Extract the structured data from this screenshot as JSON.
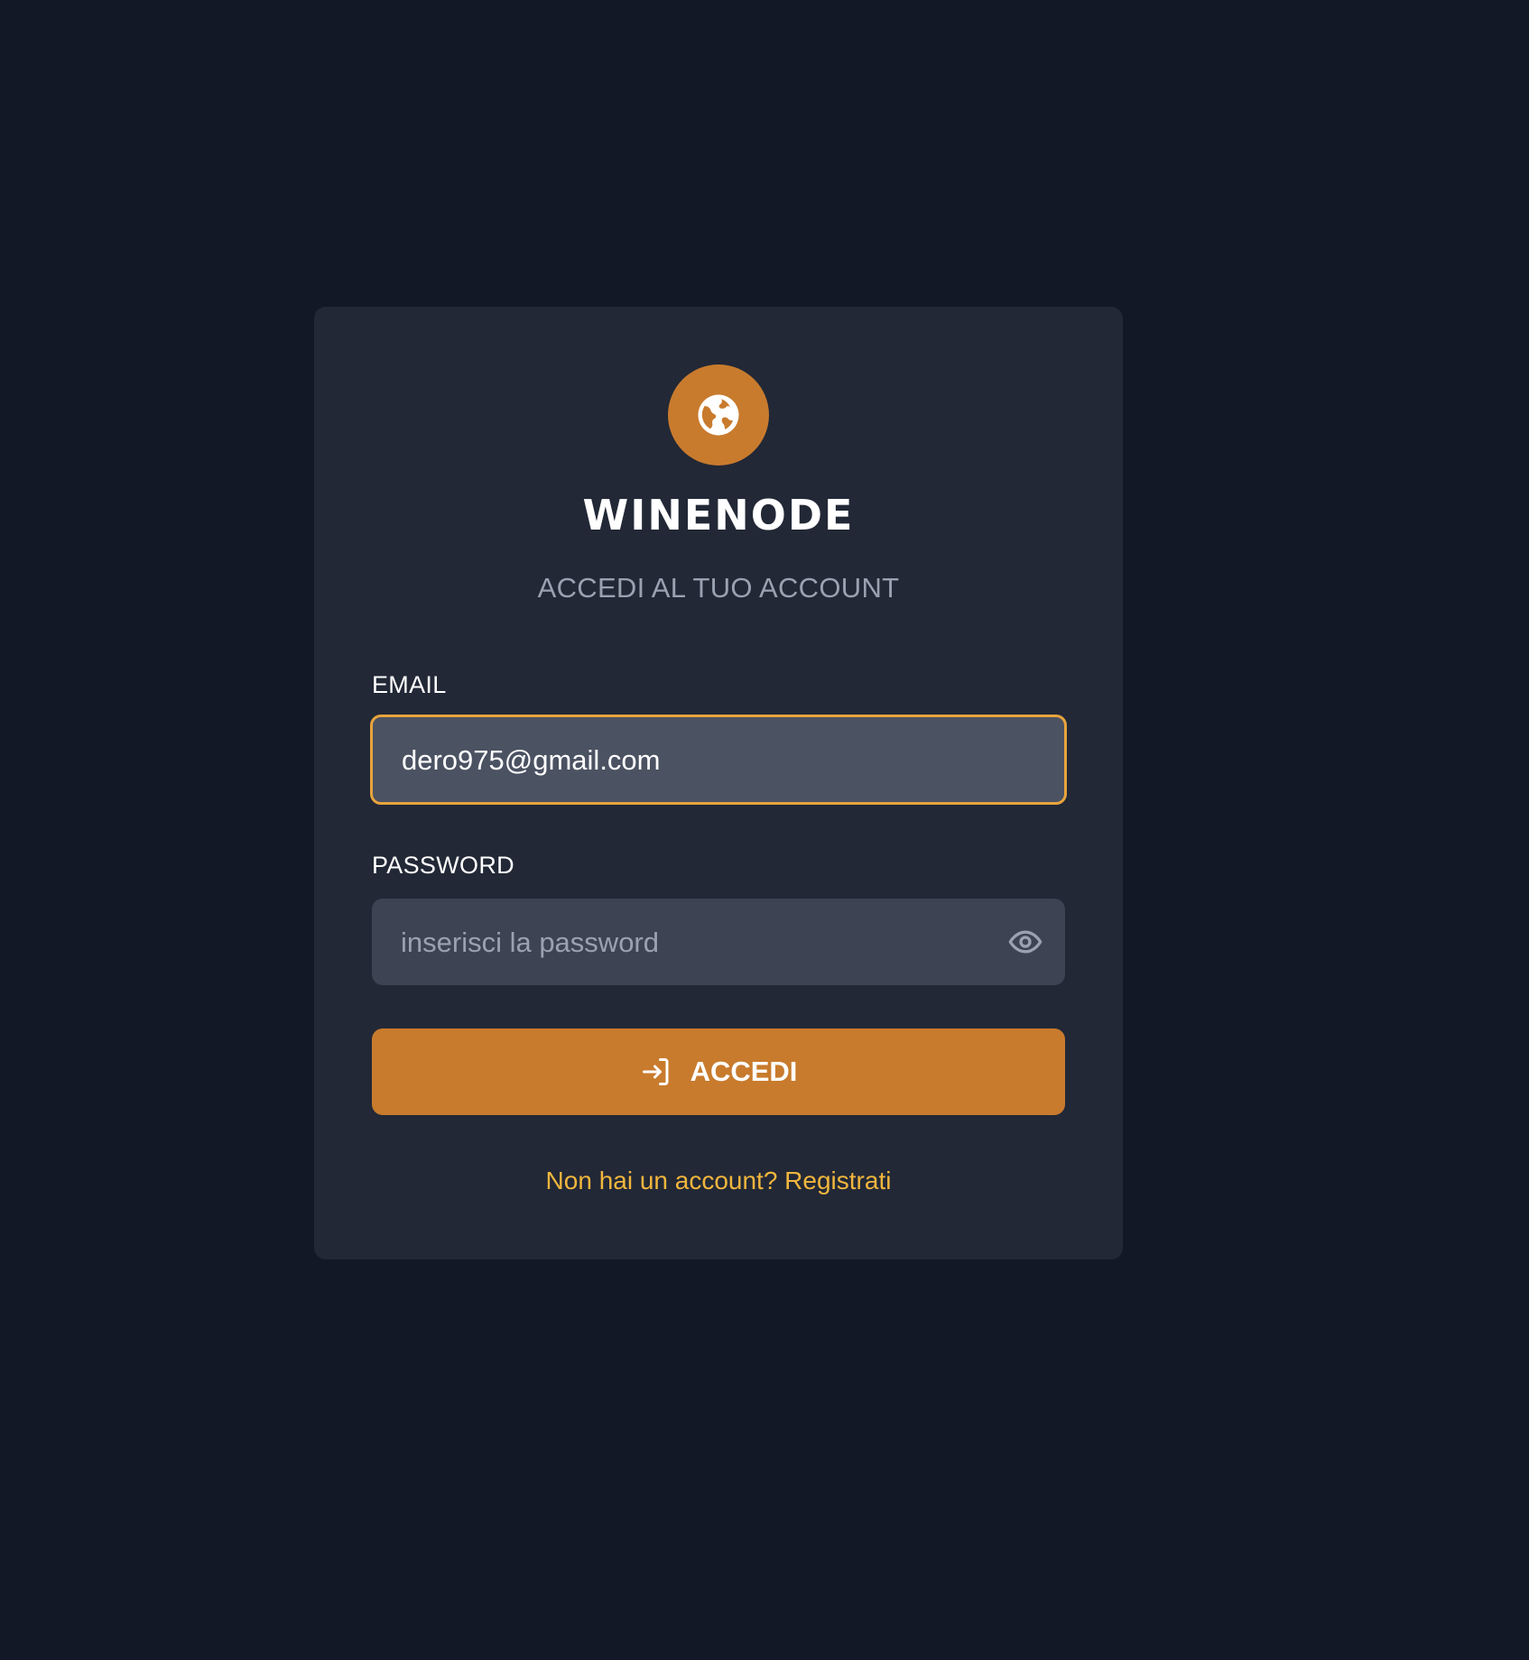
{
  "brand": {
    "name": "WINENODE",
    "logo_icon": "globe-icon"
  },
  "login": {
    "subtitle": "ACCEDI AL TUO ACCOUNT",
    "email_label": "EMAIL",
    "email_value": "dero975@gmail.com",
    "password_label": "PASSWORD",
    "password_placeholder": "inserisci la password",
    "password_toggle_icon": "eye-icon",
    "submit_label": "ACCEDI",
    "submit_icon": "login-icon",
    "signup_text": "Non hai un account? Registrati"
  },
  "colors": {
    "background": "#131826",
    "card": "#222836",
    "accent": "#c87b2d",
    "focus_border": "#e8a43c",
    "link": "#f1b63d"
  }
}
